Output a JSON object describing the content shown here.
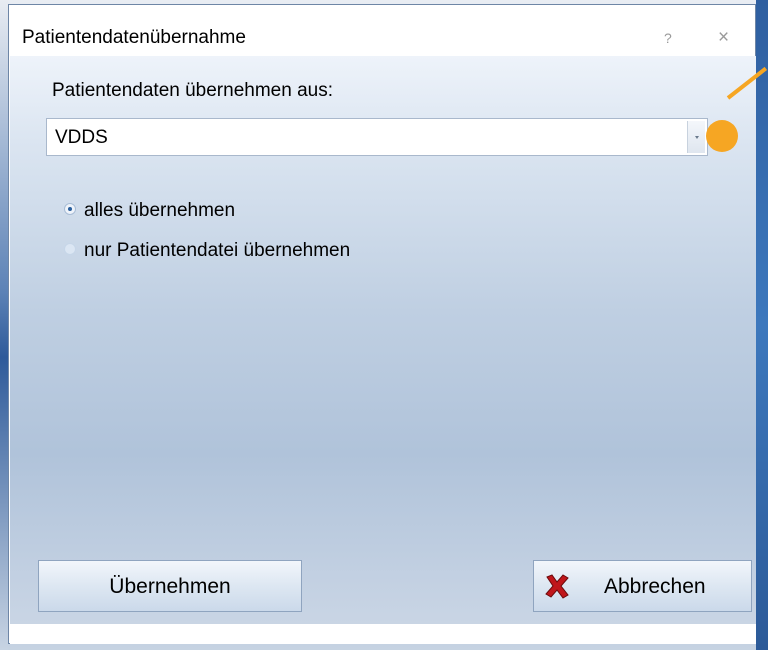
{
  "dialog": {
    "title": "Patientendatenübernahme",
    "help_glyph": "?",
    "close_glyph": "×"
  },
  "source": {
    "label": "Patientendaten übernehmen aus:",
    "selected_value": "VDDS"
  },
  "options": [
    {
      "label": "alles übernehmen",
      "checked": true
    },
    {
      "label": "nur Patientendatei übernehmen",
      "checked": false
    }
  ],
  "buttons": {
    "ok_label": "Übernehmen",
    "cancel_label": "Abbrechen"
  },
  "colors": {
    "callout": "#f6a623",
    "cancel_icon": "#c0161b"
  },
  "icons": {
    "cancel": "red-x-icon",
    "dropdown": "chevron-down-icon"
  }
}
